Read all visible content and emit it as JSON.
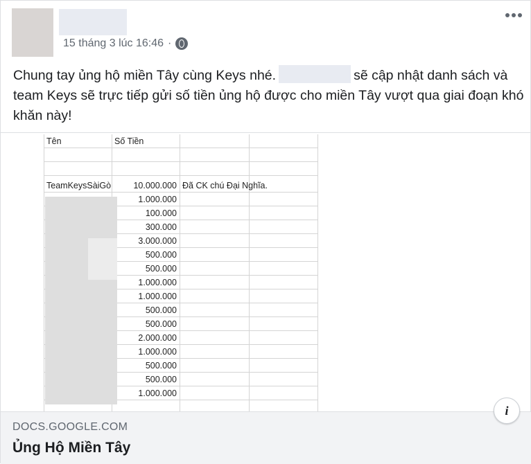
{
  "post": {
    "timestamp": "15 tháng 3 lúc 16:46",
    "separator": "·",
    "text_part1": "Chung tay ủng hộ miền Tây cùng Keys nhé.",
    "text_part2": "sẽ cập nhật danh sách và team Keys sẽ trực tiếp gửi số tiền ủng hộ được cho miền Tây vượt qua giai đoạn khó khăn này!",
    "icons": {
      "privacy": "globe-icon",
      "menu": "more-icon",
      "info": "info-icon"
    }
  },
  "sheet": {
    "header_name": "Tên",
    "header_amount": "Số Tiền",
    "first_row": {
      "name": "TeamKeysSàiGò",
      "amount": "10.000.000",
      "note": "Đã CK chú Đại Nghĩa."
    },
    "amounts": [
      "1.000.000",
      "100.000",
      "300.000",
      "3.000.000",
      "500.000",
      "500.000",
      "1.000.000",
      "1.000.000",
      "500.000",
      "500.000",
      "2.000.000",
      "1.000.000",
      "500.000",
      "500.000",
      "1.000.000"
    ]
  },
  "link": {
    "domain": "DOCS.GOOGLE.COM",
    "title": "Ủng Hộ Miền Tây"
  }
}
